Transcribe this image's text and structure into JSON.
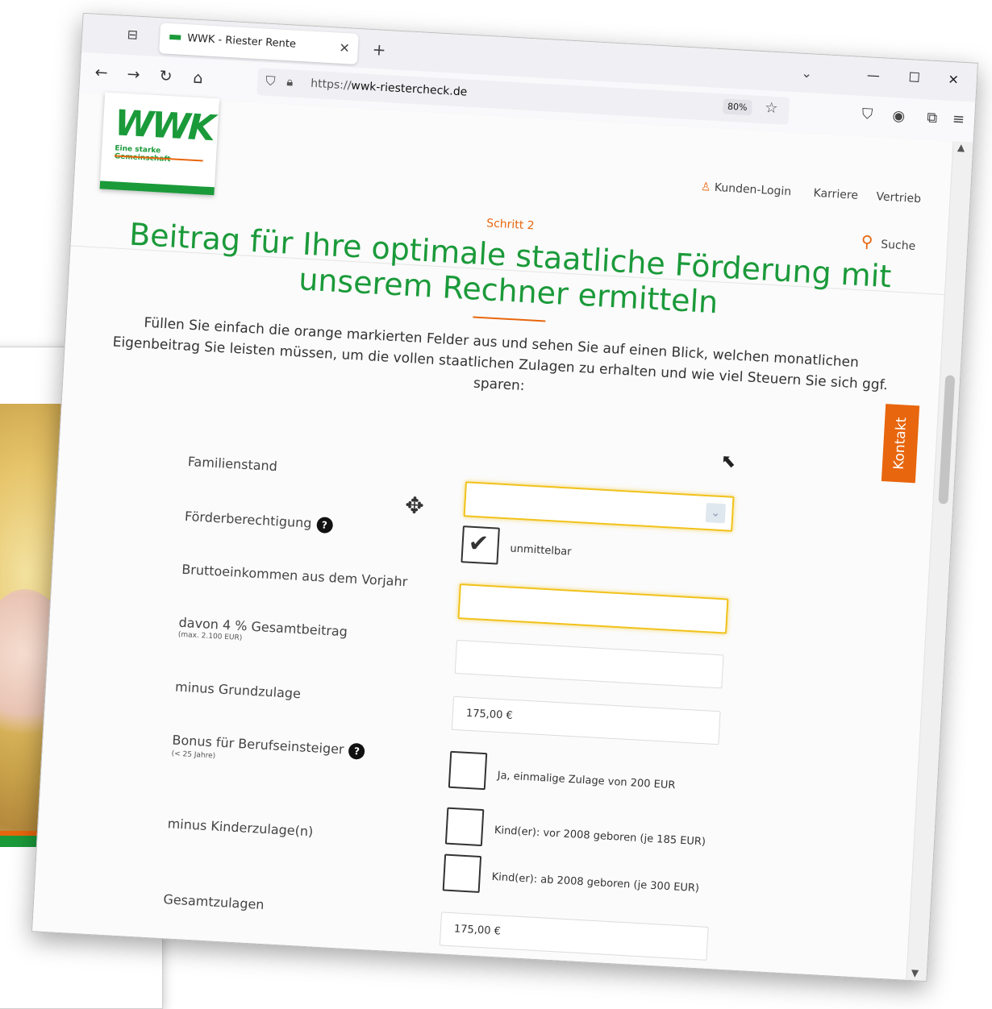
{
  "browser": {
    "tab_title": "WWK - Riester Rente",
    "url_scheme": "https://",
    "url_host": "wwk-riestercheck.de",
    "zoom": "80%"
  },
  "header": {
    "logo_text": "WWK",
    "logo_slogan": "Eine starke Gemeinschaft",
    "nav": [
      "Kunden-Login",
      "Karriere",
      "Vertrieb"
    ],
    "search_label": "Suche"
  },
  "main": {
    "step": "Schritt 2",
    "headline": "Beitrag für Ihre optimale staatliche Förderung mit unserem Rechner ermitteln",
    "intro": "Füllen Sie einfach die orange markierten Felder aus und sehen Sie auf einen Blick, welchen monatlichen Eigenbeitrag Sie leisten müssen, um die vollen staatlichen Zulagen zu erhalten und wie viel Steuern Sie sich ggf. sparen:",
    "kontakt": "Kontakt"
  },
  "form": {
    "familienstand": {
      "label": "Familienstand",
      "value": ""
    },
    "foerderberechtigung": {
      "label": "Förderberechtigung",
      "help": "?",
      "option": "unmittelbar",
      "checked": true
    },
    "brutto": {
      "label": "Bruttoeinkommen aus dem Vorjahr",
      "value": ""
    },
    "gesamtbeitrag": {
      "label": "davon 4 % Gesamtbeitrag",
      "note": "(max. 2.100 EUR)",
      "value": ""
    },
    "grundzulage": {
      "label": "minus Grundzulage",
      "value": "175,00 €"
    },
    "bonus": {
      "label": "Bonus für Berufseinsteiger",
      "note": "(< 25 Jahre)",
      "help": "?",
      "option": "Ja, einmalige Zulage von 200 EUR",
      "checked": false
    },
    "kinderzulage": {
      "label": "minus Kinderzulage(n)",
      "options": [
        "Kind(er): vor 2008 geboren (je 185 EUR)",
        "Kind(er): ab 2008 geboren (je 300 EUR)"
      ]
    },
    "gesamtzulagen": {
      "label": "Gesamtzulagen",
      "value": "175,00 €"
    }
  },
  "colors": {
    "brand_green": "#1b9a3a",
    "accent_orange": "#e8660d",
    "highlight_yellow": "#f1c21b"
  }
}
